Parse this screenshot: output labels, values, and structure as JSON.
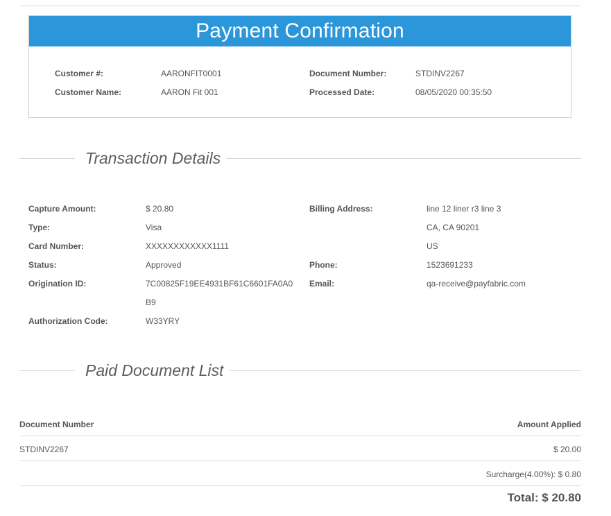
{
  "header": {
    "title": "Payment Confirmation"
  },
  "customer": {
    "customer_number_label": "Customer #:",
    "customer_number": "AARONFIT0001",
    "customer_name_label": "Customer Name:",
    "customer_name": "AARON Fit 001",
    "document_number_label": "Document Number:",
    "document_number": "STDINV2267",
    "processed_date_label": "Processed Date:",
    "processed_date": "08/05/2020 00:35:50"
  },
  "transaction": {
    "section_title": "Transaction Details",
    "capture_amount_label": "Capture Amount:",
    "capture_amount": "$ 20.80",
    "type_label": "Type:",
    "type": "Visa",
    "card_number_label": "Card Number:",
    "card_number": "XXXXXXXXXXXX1111",
    "status_label": "Status:",
    "status": "Approved",
    "origination_id_label": "Origination ID:",
    "origination_id_line1": "7C00825F19EE4931BF61C6601FA0A0",
    "origination_id_line2": "B9",
    "authorization_code_label": "Authorization Code:",
    "authorization_code": "W33YRY",
    "billing_address_label": "Billing Address:",
    "billing_address_line1": "line 12 liner r3 line 3",
    "billing_address_line2": "CA, CA 90201",
    "billing_address_line3": "US",
    "phone_label": "Phone:",
    "phone": "1523691233",
    "email_label": "Email:",
    "email": "qa-receive@payfabric.com"
  },
  "documents": {
    "section_title": "Paid Document List",
    "columns": [
      "Document Number",
      "Amount Applied"
    ],
    "rows": [
      {
        "document_number": "STDINV2267",
        "amount_applied": "$ 20.00"
      }
    ],
    "surcharge": "Surcharge(4.00%): $ 0.80",
    "total": "Total: $ 20.80"
  },
  "colors": {
    "header_bg": "#2b96d9",
    "header_text": "#ffffff",
    "text": "#555555",
    "rule": "#d9d9d9"
  }
}
